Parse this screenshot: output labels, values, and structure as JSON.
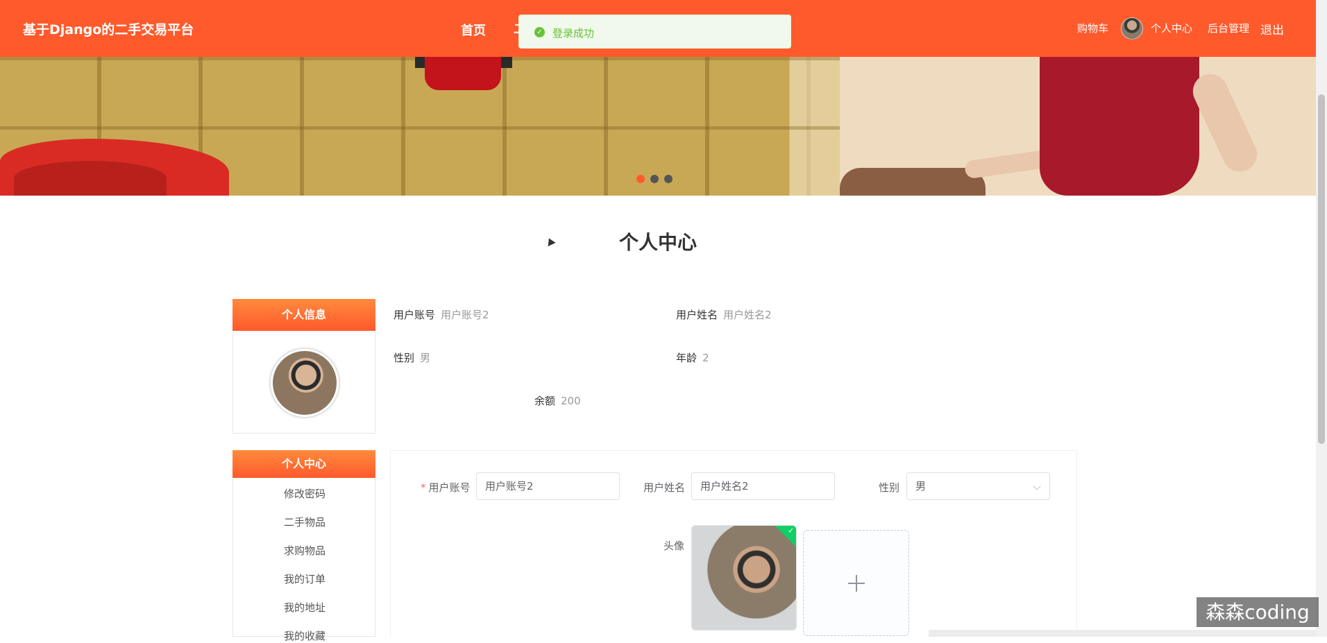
{
  "header": {
    "brand": "基于Django的二手交易平台",
    "nav_home": "首页",
    "nav_partial": "二",
    "cart": "购物车",
    "profile": "个人中心",
    "admin": "后台管理",
    "logout": "退出"
  },
  "toast": {
    "message": "登录成功"
  },
  "banner": {
    "slides": 3,
    "active_slide": 1
  },
  "page_title": "个人中心",
  "sidebar": {
    "info_title": "个人信息",
    "center_title": "个人中心",
    "menu": [
      "修改密码",
      "二手物品",
      "求购物品",
      "我的订单",
      "我的地址",
      "我的收藏"
    ]
  },
  "info": {
    "account_label": "用户账号",
    "account_value": "用户账号2",
    "name_label": "用户姓名",
    "name_value": "用户姓名2",
    "gender_label": "性别",
    "gender_value": "男",
    "age_label": "年龄",
    "age_value": "2",
    "balance_label": "余额",
    "balance_value": "200"
  },
  "form": {
    "account_label": "用户账号",
    "account_value": "用户账号2",
    "name_label": "用户姓名",
    "name_value": "用户姓名2",
    "gender_label": "性别",
    "gender_value": "男",
    "avatar_label": "头像",
    "required_mark": "*"
  },
  "watermark": "森森coding",
  "colors": {
    "primary": "#ff5a2c",
    "success": "#67c23a"
  }
}
